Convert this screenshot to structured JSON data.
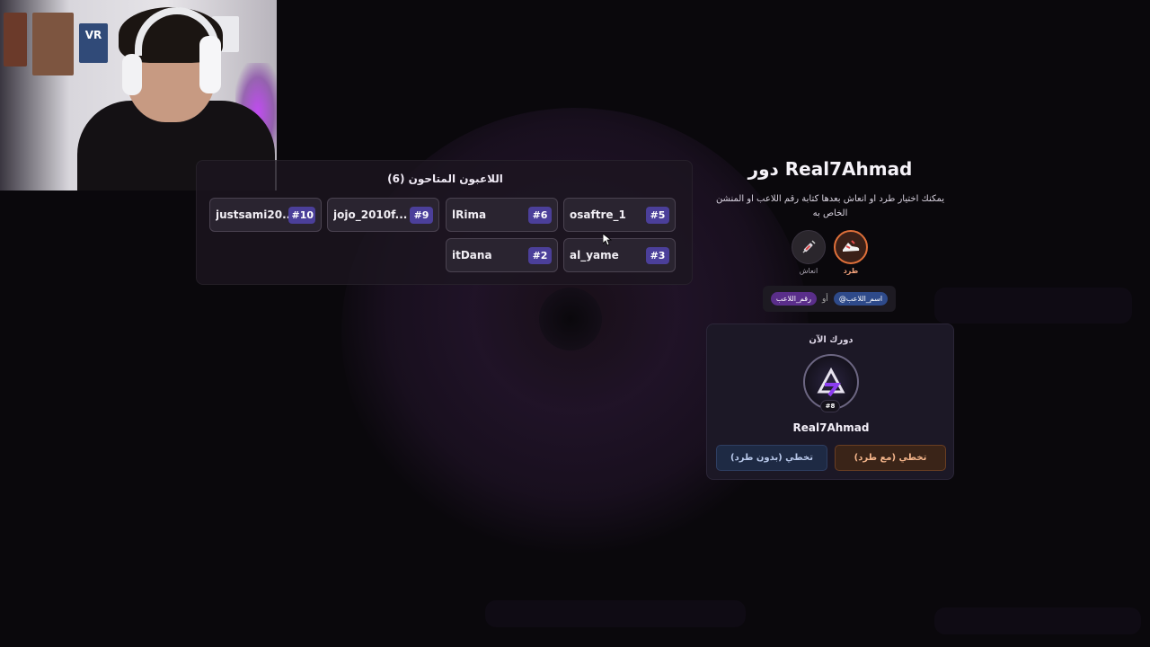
{
  "webcam": {
    "poster_text": "VR"
  },
  "players_panel": {
    "title": "اللاعبون المتاحون (6)",
    "players": [
      {
        "name": "justsami20...",
        "number": "#10"
      },
      {
        "name": "jojo_2010f...",
        "number": "#9"
      },
      {
        "name": "lRima",
        "number": "#6"
      },
      {
        "name": "osaftre_1",
        "number": "#5"
      },
      {
        "name": "itDana",
        "number": "#2"
      },
      {
        "name": "al_yame",
        "number": "#3"
      }
    ]
  },
  "turn_panel": {
    "title": "دور Real7Ahmad",
    "description": "يمكنك اختيار طرد او انعاش بعدها كتابة رقم اللاعب او المنشن الخاص به",
    "actions": [
      {
        "label": "طرد",
        "icon": "shoe-kick-icon",
        "color": "#e0703a"
      },
      {
        "label": "انعاش",
        "icon": "syringe-icon",
        "color": "#e04848"
      }
    ],
    "tags": {
      "name_tag": "@اسم_اللاعب",
      "or": "أو",
      "number_tag": "رقم_اللاعب"
    }
  },
  "current_turn": {
    "label": "دورك الآن",
    "avatar_icon": "triangle-logo-icon",
    "avatar_number": "#8",
    "player_name": "Real7Ahmad",
    "skip_with_kick": "تخطي (مع طرد)",
    "skip_without_kick": "تخطي (بدون طرد)"
  },
  "colors": {
    "accent": "#4b3f9a",
    "kick": "#e0703a",
    "revive": "#e04848"
  }
}
